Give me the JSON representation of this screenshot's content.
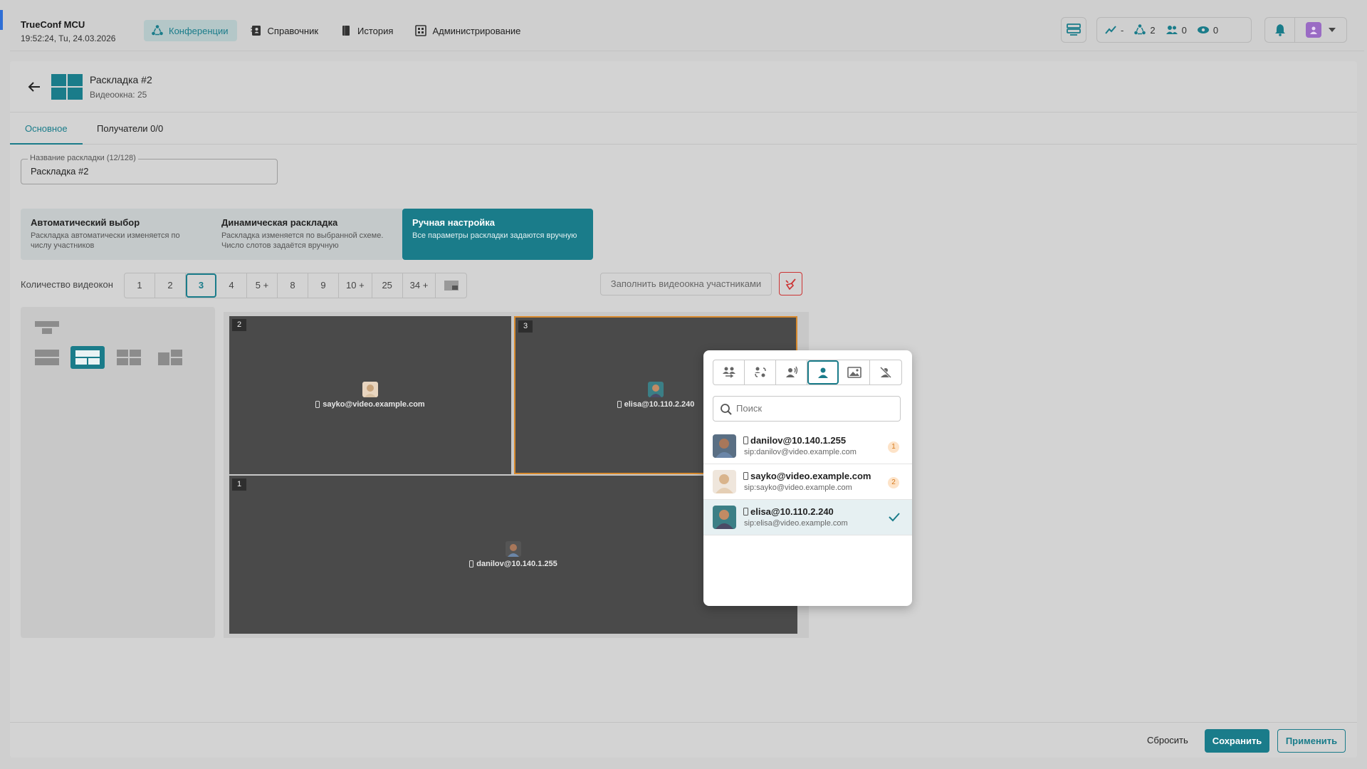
{
  "app": {
    "name": "TrueConf MCU",
    "datetime": "19:52:24, Tu, 24.03.2026"
  },
  "nav": [
    {
      "label": "Конференции",
      "icon": "conferences-icon",
      "active": true
    },
    {
      "label": "Справочник",
      "icon": "address-book-icon"
    },
    {
      "label": "История",
      "icon": "history-icon"
    },
    {
      "label": "Администрирование",
      "icon": "admin-icon"
    }
  ],
  "toolbar": {
    "stats": {
      "load": "-",
      "conferences": "2",
      "participants": "0",
      "viewers": "0"
    }
  },
  "layout": {
    "title": "Раскладка #2",
    "subtitle": "Видеоокна: 25"
  },
  "tabs": [
    {
      "label": "Основное",
      "active": true
    },
    {
      "label": "Получатели 0/0"
    }
  ],
  "name_field": {
    "label": "Название раскладки (12/128)",
    "value": "Раскладка #2"
  },
  "modes": [
    {
      "title": "Автоматический выбор",
      "desc": "Раскладка автоматически изменяется по числу участников"
    },
    {
      "title": "Динамическая раскладка",
      "desc": "Раскладка изменяется по выбранной схеме. Число слотов задаётся вручную"
    },
    {
      "title": "Ручная настройка",
      "desc": "Все параметры раскладки задаются вручную",
      "active": true
    }
  ],
  "video_count": {
    "label": "Количество видеокон",
    "options": [
      "1",
      "2",
      "3",
      "4",
      "5 +",
      "8",
      "9",
      "10 +",
      "25",
      "34 +"
    ],
    "selected": "3"
  },
  "fill_button": "Заполнить видеоокна участниками",
  "slots": [
    {
      "num": "2",
      "name": "sayko@video.example.com"
    },
    {
      "num": "3",
      "name": "elisa@10.110.2.240",
      "selected": true
    },
    {
      "num": "1",
      "name": "danilov@10.140.1.255"
    }
  ],
  "popup": {
    "search_placeholder": "Поиск",
    "participants": [
      {
        "name": "danilov@10.140.1.255",
        "sip": "sip:danilov@video.example.com",
        "badge": "1"
      },
      {
        "name": "sayko@video.example.com",
        "sip": "sip:sayko@video.example.com",
        "badge": "2"
      },
      {
        "name": "elisa@10.110.2.240",
        "sip": "sip:elisa@video.example.com",
        "selected": true
      }
    ]
  },
  "footer": {
    "reset": "Сбросить",
    "save": "Сохранить",
    "apply": "Применить"
  },
  "colors": {
    "accent": "#1a7c8a",
    "selected_slot": "#d88a2e",
    "danger": "#cc3333"
  }
}
